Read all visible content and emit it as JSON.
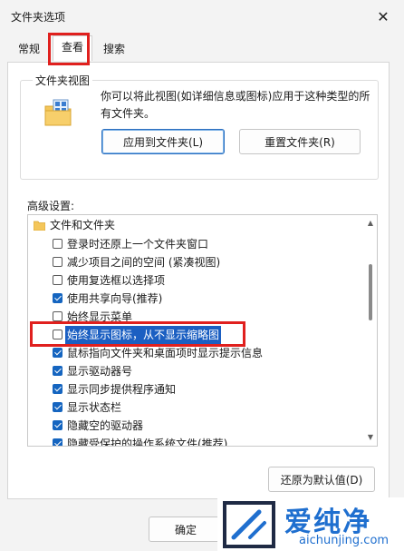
{
  "window": {
    "title": "文件夹选项"
  },
  "tabs": [
    {
      "label": "常规"
    },
    {
      "label": "查看"
    },
    {
      "label": "搜索"
    }
  ],
  "folder_views": {
    "group_label": "文件夹视图",
    "description": "你可以将此视图(如详细信息或图标)应用于这种类型的所有文件夹。",
    "apply_button": "应用到文件夹(L)",
    "reset_button": "重置文件夹(R)"
  },
  "advanced": {
    "label": "高级设置:",
    "root": "文件和文件夹",
    "items": [
      {
        "label": "登录时还原上一个文件夹窗口",
        "checked": false
      },
      {
        "label": "减少项目之间的空间 (紧凑视图)",
        "checked": false
      },
      {
        "label": "使用复选框以选择项",
        "checked": false
      },
      {
        "label": "使用共享向导(推荐)",
        "checked": true
      },
      {
        "label": "始终显示菜单",
        "checked": false
      },
      {
        "label": "始终显示图标，从不显示缩略图",
        "checked": false,
        "selected": true
      },
      {
        "label": "鼠标指向文件夹和桌面项时显示提示信息",
        "checked": true
      },
      {
        "label": "显示驱动器号",
        "checked": true
      },
      {
        "label": "显示同步提供程序通知",
        "checked": true
      },
      {
        "label": "显示状态栏",
        "checked": true
      },
      {
        "label": "隐藏空的驱动器",
        "checked": true
      },
      {
        "label": "隐藏受保护的操作系统文件(推荐)",
        "checked": true
      }
    ],
    "restore_button": "还原为默认值(D)"
  },
  "footer": {
    "ok_button": "确定"
  },
  "watermark": {
    "brand": "爱纯净",
    "url": "aichunjing.com"
  },
  "colors": {
    "accent": "#1565c0",
    "highlight_box": "#e0201e",
    "selection": "#1b5fc2"
  }
}
